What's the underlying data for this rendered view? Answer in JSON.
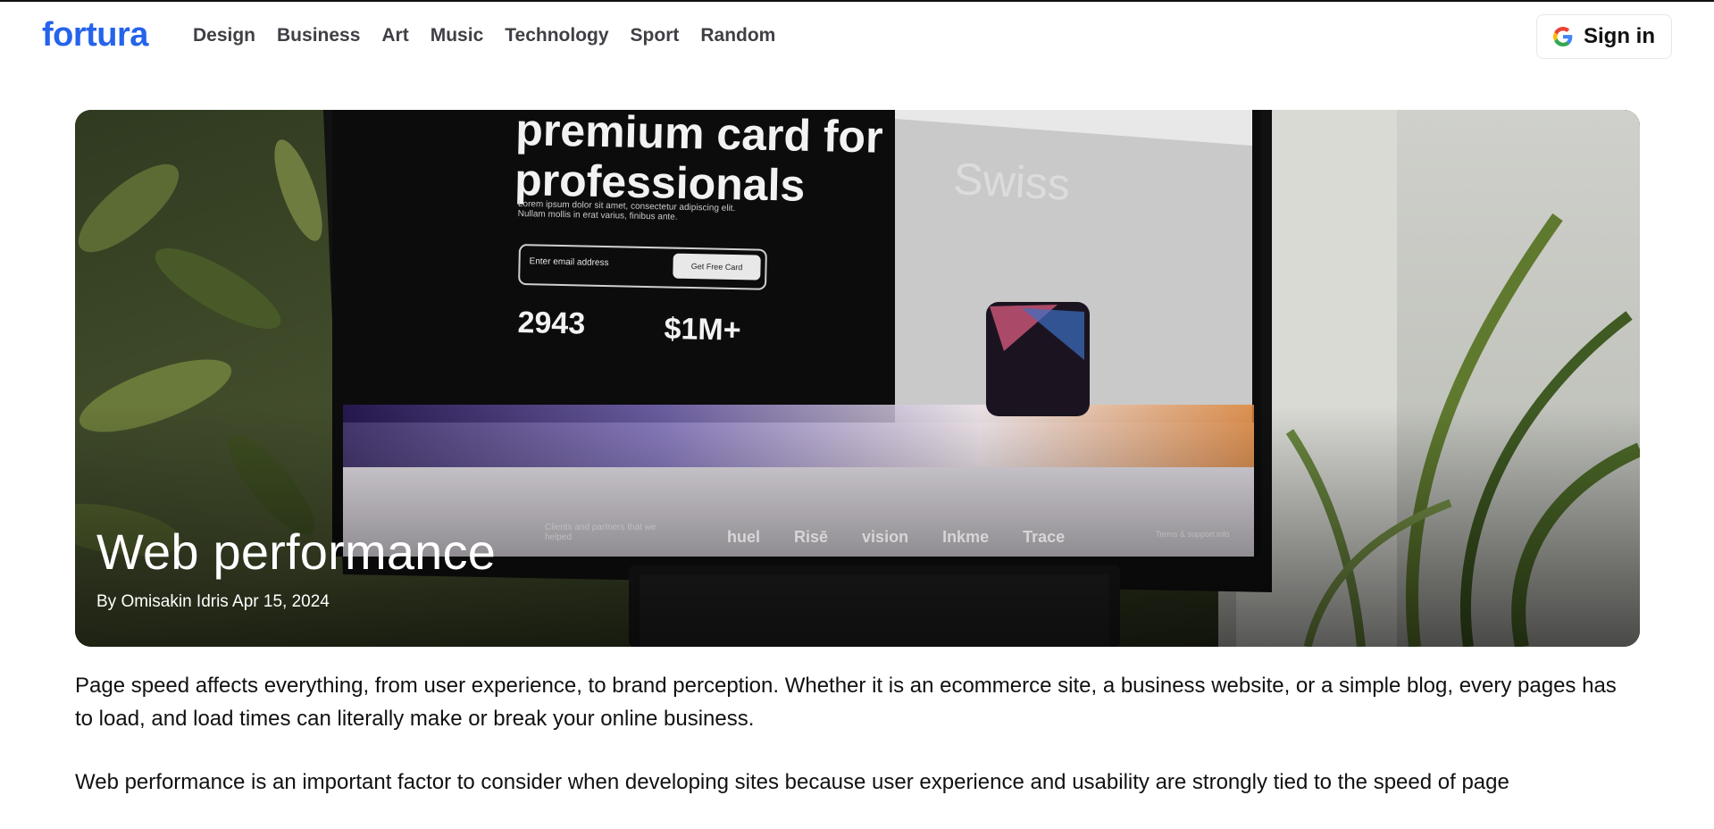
{
  "header": {
    "logo": "fortura",
    "nav": [
      "Design",
      "Business",
      "Art",
      "Music",
      "Technology",
      "Sport",
      "Random"
    ],
    "signin_label": "Sign in",
    "signin_icon": "google-icon"
  },
  "hero": {
    "title": "Web performance",
    "author": "Omisakin Idris",
    "date": "Apr 15, 2024",
    "byline": "By Omisakin Idris Apr 15, 2024",
    "screen": {
      "headline": "premium card for professionals",
      "subline": "Lorem ipsum dolor sit amet, consectetur adipiscing elit. Nullam mollis in erat varius, finibus ante.",
      "email_placeholder": "Enter email address",
      "email_button": "Get Free Card",
      "stat1": "2943",
      "stat2": "$1M+",
      "brand": "Swiss",
      "clients_text": "Clients and partners that we helped",
      "partner_logos": [
        "huel",
        "Risē",
        "vision",
        "Inkme",
        "Trace"
      ],
      "fineprint": "Terms & support info"
    }
  },
  "article": {
    "paragraphs": [
      "Page speed affects everything, from user experience, to brand perception. Whether it is an ecommerce site, a business website, or a simple blog, every pages has to load, and load times can literally make or break your online business.",
      "Web performance is an important factor to consider when developing sites because user experience and usability are strongly tied to the speed of page"
    ]
  },
  "colors": {
    "brand": "#2563eb",
    "nav_text": "#3f3f46",
    "text": "#111111",
    "background": "#ffffff"
  }
}
